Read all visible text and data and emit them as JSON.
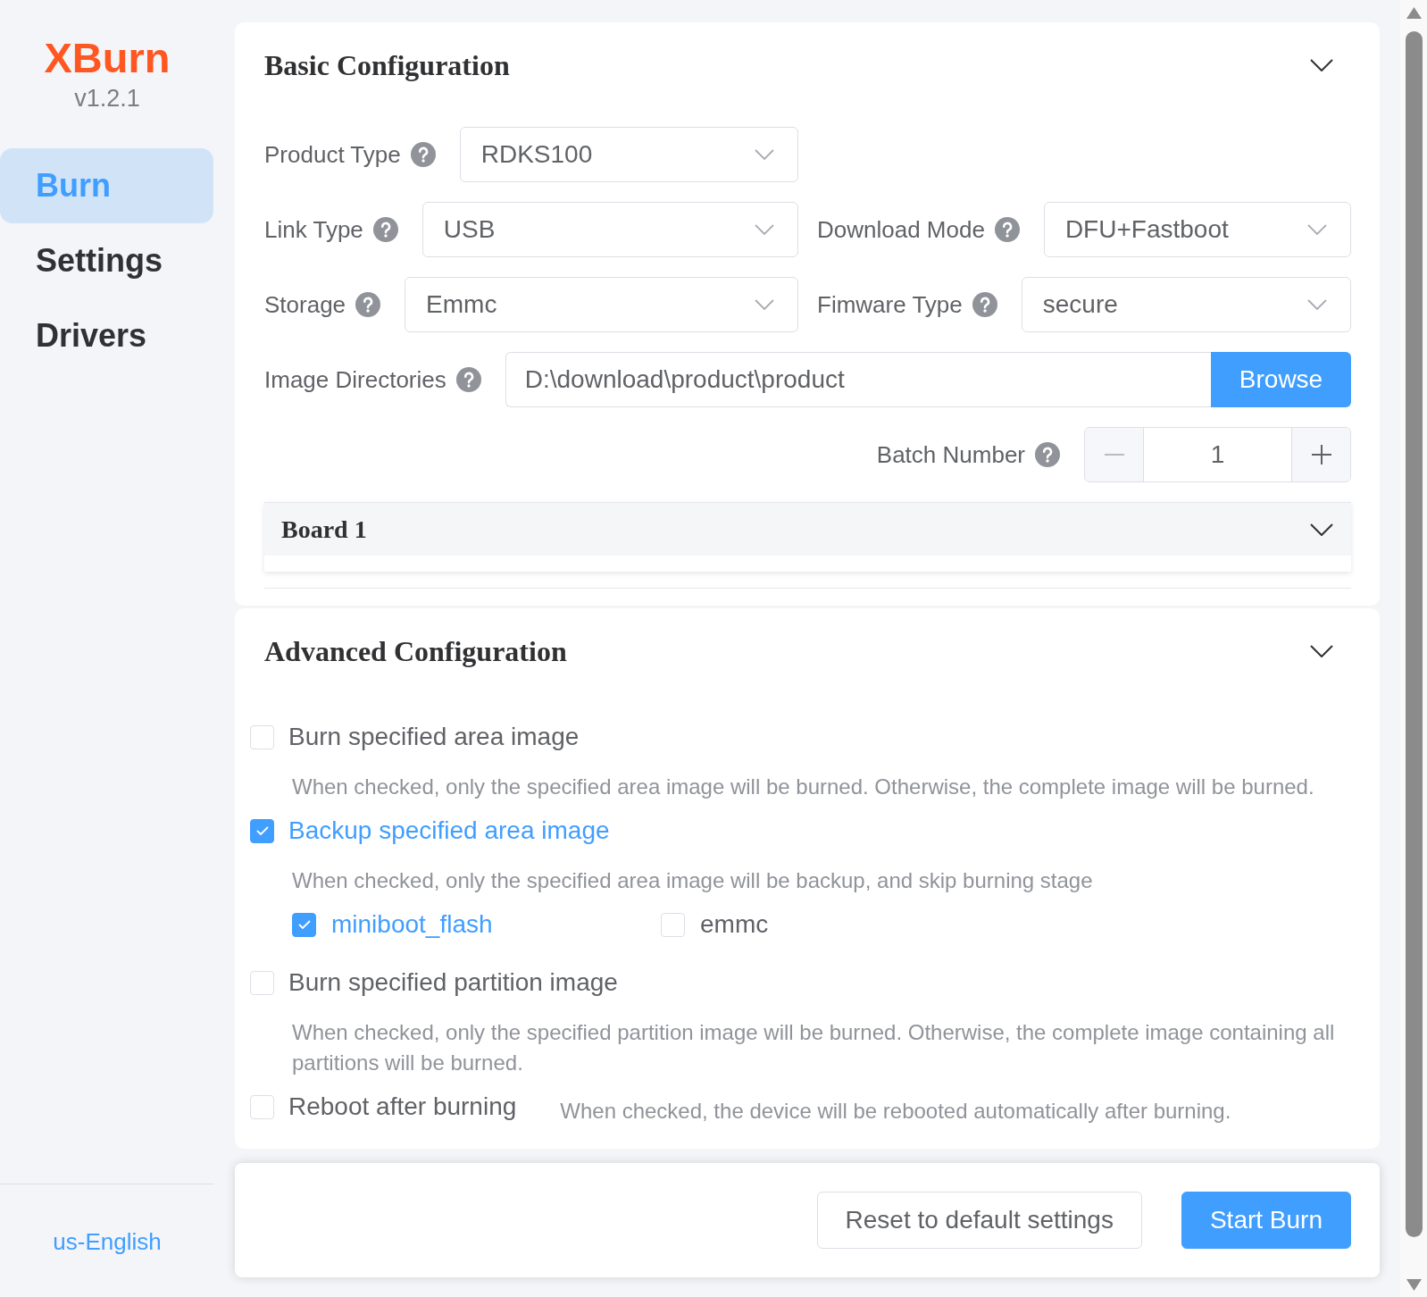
{
  "sidebar": {
    "logo": "XBurn",
    "version": "v1.2.1",
    "nav": [
      {
        "label": "Burn",
        "selected": true
      },
      {
        "label": "Settings",
        "selected": false
      },
      {
        "label": "Drivers",
        "selected": false
      }
    ],
    "language": "us-English"
  },
  "basic_configuration": {
    "title": "Basic Configuration",
    "rows": [
      [
        {
          "kind": "select",
          "label": "Product Type",
          "value": "RDKS100"
        }
      ],
      [
        {
          "kind": "select",
          "label": "Link Type",
          "value": "USB"
        },
        {
          "kind": "select",
          "label": "Download Mode",
          "value": "DFU+Fastboot"
        }
      ],
      [
        {
          "kind": "select",
          "label": "Storage",
          "value": "Emmc"
        },
        {
          "kind": "select",
          "label": "Fimware Type",
          "value": "secure"
        }
      ],
      [
        {
          "kind": "path",
          "label": "Image Directories",
          "value": "D:\\download\\product\\product",
          "button": "Browse"
        }
      ],
      [
        {
          "kind": "stepper",
          "label": "Batch Number",
          "value": "1"
        }
      ]
    ],
    "boards": [
      {
        "title": "Board 1"
      }
    ]
  },
  "advanced_configuration": {
    "title": "Advanced Configuration",
    "options": [
      {
        "kind": "stacked",
        "label": "Burn specified area image",
        "checked": false,
        "description": "When checked, only the specified area image will be burned. Otherwise, the complete image will be burned."
      },
      {
        "kind": "stacked",
        "label": "Backup specified area image",
        "checked": true,
        "description": "When checked, only the specified area image will be backup, and skip burning stage",
        "sub_options": [
          {
            "label": "miniboot_flash",
            "checked": true
          },
          {
            "label": "emmc",
            "checked": false
          }
        ]
      },
      {
        "kind": "stacked",
        "label": "Burn specified partition image",
        "checked": false,
        "description": "When checked, only the specified partition image will be burned. Otherwise, the complete image containing all partitions will be burned."
      },
      {
        "kind": "inline",
        "label": "Reboot after burning",
        "checked": false,
        "description": "When checked, the device will be rebooted automatically after burning."
      }
    ]
  },
  "footer": {
    "buttons": [
      {
        "kind": "default",
        "label": "Reset to default settings"
      },
      {
        "kind": "primary",
        "label": "Start Burn"
      }
    ]
  }
}
